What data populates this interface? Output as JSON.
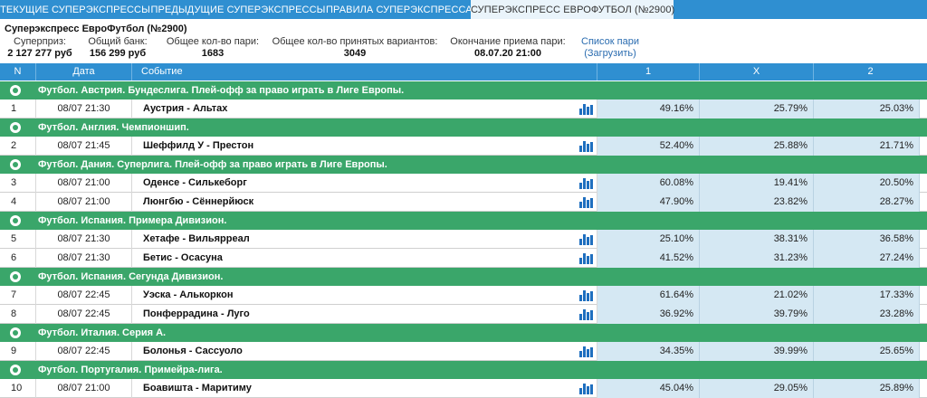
{
  "tabs": [
    {
      "label": "ТЕКУЩИЕ СУПЕРЭКСПРЕССЫ",
      "active": false
    },
    {
      "label": "ПРЕДЫДУЩИЕ СУПЕРЭКСПРЕССЫ",
      "active": false
    },
    {
      "label": "ПРАВИЛА СУПЕРЭКСПРЕССА",
      "active": false
    },
    {
      "label": "СУПЕРЭКСПРЕСС ЕВРОФУТБОЛ (№2900)",
      "active": true
    }
  ],
  "title": "Суперэкспресс ЕвроФутбол (№2900)",
  "stats": {
    "superprize": {
      "label": "Суперприз:",
      "value": "2 127 277 руб"
    },
    "bank": {
      "label": "Общий банк:",
      "value": "156 299 руб"
    },
    "bets": {
      "label": "Общее кол-во пари:",
      "value": "1683"
    },
    "variants": {
      "label": "Общее кол-во принятых вариантов:",
      "value": "3049"
    },
    "deadline": {
      "label": "Окончание приема пари:",
      "value": "08.07.20 21:00"
    },
    "list_link": {
      "line1": "Список пари",
      "line2": "(Загрузить)"
    }
  },
  "columns": {
    "num": "N",
    "date": "Дата",
    "event": "Событие",
    "c1": "1",
    "cx": "X",
    "c2": "2"
  },
  "groups": [
    {
      "title": "Футбол. Австрия. Бундеслига. Плей-офф за право играть в Лиге Европы.",
      "rows": [
        {
          "n": "1",
          "date": "08/07 21:30",
          "event": "Аустрия - Альтах",
          "p1": "49.16%",
          "px": "25.79%",
          "p2": "25.03%"
        }
      ]
    },
    {
      "title": "Футбол. Англия. Чемпионшип.",
      "rows": [
        {
          "n": "2",
          "date": "08/07 21:45",
          "event": "Шеффилд У - Престон",
          "p1": "52.40%",
          "px": "25.88%",
          "p2": "21.71%"
        }
      ]
    },
    {
      "title": "Футбол. Дания. Суперлига. Плей-офф за право играть в Лиге Европы.",
      "rows": [
        {
          "n": "3",
          "date": "08/07 21:00",
          "event": "Оденсе - Силькеборг",
          "p1": "60.08%",
          "px": "19.41%",
          "p2": "20.50%"
        },
        {
          "n": "4",
          "date": "08/07 21:00",
          "event": "Люнгбю - Сённерйюск",
          "p1": "47.90%",
          "px": "23.82%",
          "p2": "28.27%"
        }
      ]
    },
    {
      "title": "Футбол. Испания. Примера Дивизион.",
      "rows": [
        {
          "n": "5",
          "date": "08/07 21:30",
          "event": "Хетафе - Вильярреал",
          "p1": "25.10%",
          "px": "38.31%",
          "p2": "36.58%"
        },
        {
          "n": "6",
          "date": "08/07 21:30",
          "event": "Бетис - Осасуна",
          "p1": "41.52%",
          "px": "31.23%",
          "p2": "27.24%"
        }
      ]
    },
    {
      "title": "Футбол. Испания. Сегунда Дивизион.",
      "rows": [
        {
          "n": "7",
          "date": "08/07 22:45",
          "event": "Уэска - Алькоркон",
          "p1": "61.64%",
          "px": "21.02%",
          "p2": "17.33%"
        },
        {
          "n": "8",
          "date": "08/07 22:45",
          "event": "Понферрадина - Луго",
          "p1": "36.92%",
          "px": "39.79%",
          "p2": "23.28%"
        }
      ]
    },
    {
      "title": "Футбол. Италия. Серия А.",
      "rows": [
        {
          "n": "9",
          "date": "08/07 22:45",
          "event": "Болонья - Сассуоло",
          "p1": "34.35%",
          "px": "39.99%",
          "p2": "25.65%"
        }
      ]
    },
    {
      "title": "Футбол. Португалия. Примейра-лига.",
      "rows": [
        {
          "n": "10",
          "date": "08/07 21:00",
          "event": "Боавишта - Маритиму",
          "p1": "45.04%",
          "px": "29.05%",
          "p2": "25.89%"
        }
      ]
    }
  ],
  "colors": {
    "tab_bar": "#2f8fd1",
    "group_bar": "#3aa66a",
    "pct_cell": "#d5e8f3",
    "chart_icon": "#1f6fbf"
  },
  "icons": {
    "group": "football-icon",
    "row": "bar-chart-icon"
  }
}
